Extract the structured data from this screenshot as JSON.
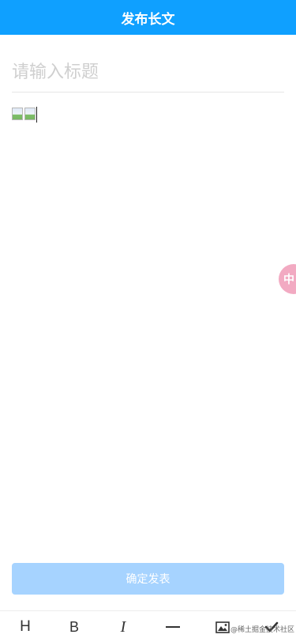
{
  "header": {
    "title": "发布长文",
    "background": "#0fa0ff"
  },
  "title_field": {
    "placeholder": "请输入标题",
    "value": ""
  },
  "editor": {
    "content": "two broken inline images followed by text cursor"
  },
  "float_badge": {
    "text": "中",
    "color": "#f2aac2"
  },
  "submit": {
    "label": "确定发表",
    "color": "#a6d3ff"
  },
  "toolbar": {
    "items": [
      {
        "label": "H",
        "icon": "heading-icon"
      },
      {
        "label": "B",
        "icon": "bold-icon"
      },
      {
        "label": "I",
        "icon": "italic-icon"
      },
      {
        "label": "",
        "icon": "horizontal-rule-icon"
      },
      {
        "label": "",
        "icon": "image-icon"
      },
      {
        "label": "",
        "icon": "checkmark-icon"
      }
    ]
  },
  "watermark": {
    "text": "@稀土掘金技术社区"
  }
}
